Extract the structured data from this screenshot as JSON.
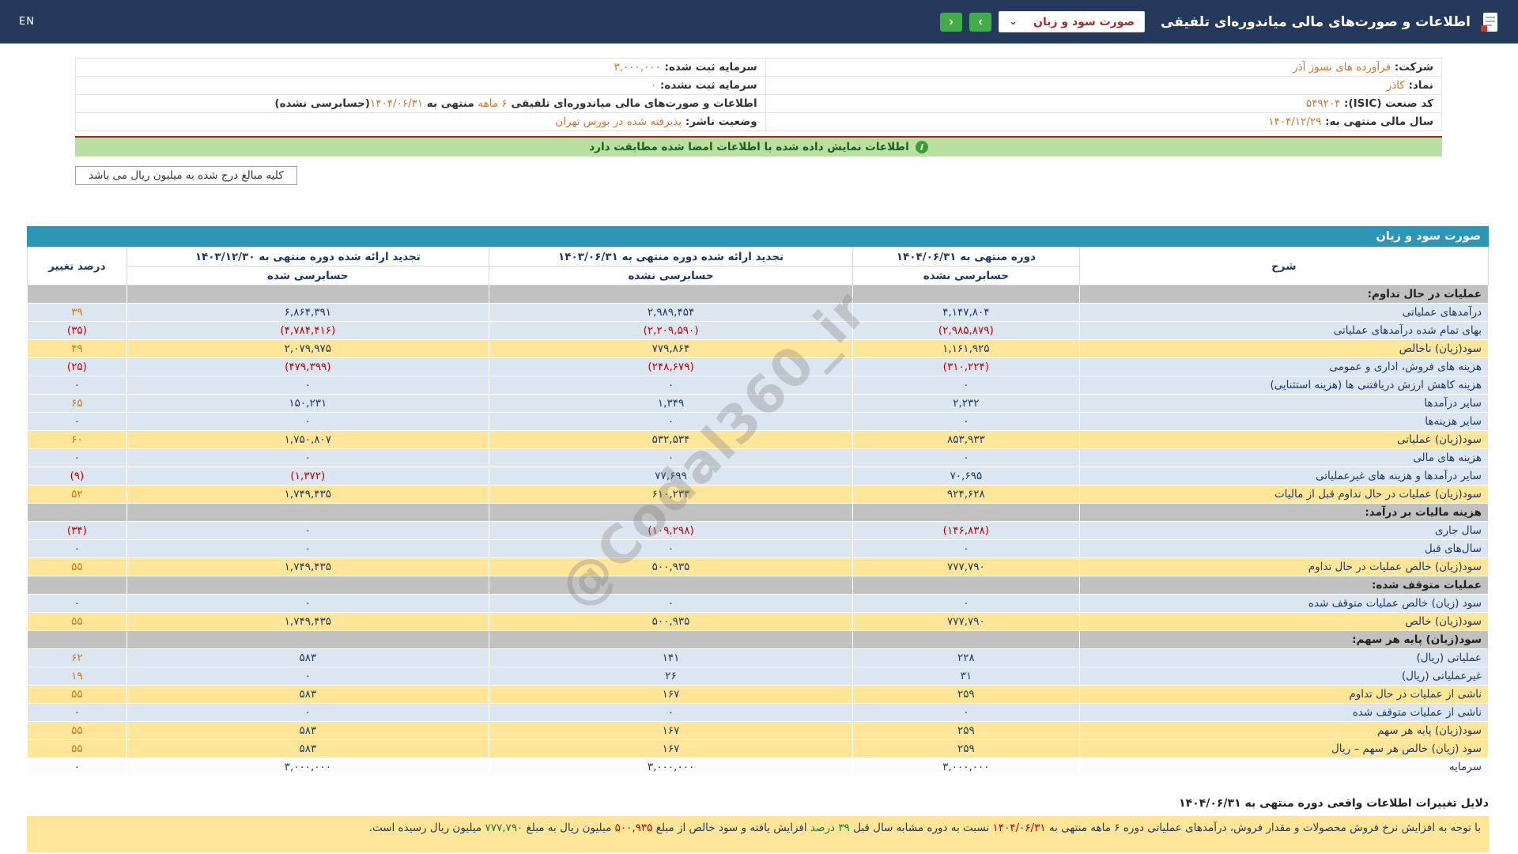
{
  "colors": {
    "topbar_bg": "#24395c",
    "accent_teal": "#2d96b5",
    "row_blue": "#dce6f1",
    "row_yellow": "#ffe699",
    "row_section": "#c1c1c1",
    "value_navy": "#1f3864",
    "value_red": "#c00000",
    "value_orange": "#bf7d1e",
    "info_orange": "#d0762c",
    "banner_green": "#b9dfa3",
    "nav_green": "#3fae49"
  },
  "topbar": {
    "title": "اطلاعات و صورت‌های مالی میاندوره‌ای تلفیقی",
    "statement_select_value": "صورت سود و زیان",
    "select_caret": "⌄",
    "nav_right_glyph": "›",
    "nav_left_glyph": "‹",
    "lang_toggle": "EN"
  },
  "info": {
    "rows": [
      {
        "right": [
          {
            "t": "شرکت: ",
            "c": "l"
          },
          {
            "t": "فرآورده های نسوز آذر",
            "c": "o"
          }
        ],
        "left": [
          {
            "t": "سرمایه ثبت شده: ",
            "c": "l"
          },
          {
            "t": "۳,۰۰۰,۰۰۰",
            "c": "o"
          }
        ]
      },
      {
        "right": [
          {
            "t": "نماد: ",
            "c": "l"
          },
          {
            "t": "کاذر",
            "c": "o"
          }
        ],
        "left": [
          {
            "t": "سرمایه ثبت نشده: ",
            "c": "l"
          },
          {
            "t": "۰",
            "c": "o"
          }
        ]
      },
      {
        "right": [
          {
            "t": "کد صنعت (ISIC): ",
            "c": "l"
          },
          {
            "t": "۵۴۹۲۰۴",
            "c": "o"
          }
        ],
        "left": [
          {
            "t": "اطلاعات و صورت‌های مالی میاندوره‌ای تلفیقی ",
            "c": "l"
          },
          {
            "t": "۶ ماهه",
            "c": "o"
          },
          {
            "t": " منتهی به ",
            "c": "l"
          },
          {
            "t": "۱۴۰۴/۰۶/۳۱",
            "c": "o"
          },
          {
            "t": "(حسابرسی نشده)",
            "c": "l"
          }
        ]
      },
      {
        "right": [
          {
            "t": "سال مالی منتهی به: ",
            "c": "l"
          },
          {
            "t": "۱۴۰۴/۱۲/۲۹",
            "c": "o"
          }
        ],
        "left": [
          {
            "t": "وضعیت ناشر: ",
            "c": "l"
          },
          {
            "t": "پذیرفته شده در بورس تهران",
            "c": "o"
          }
        ]
      }
    ]
  },
  "banner": {
    "text": "اطلاعات نمایش داده شده با اطلاعات امضا شده مطابقت دارد",
    "icon": "info-icon"
  },
  "units_note": "کلیه مبالغ درج شده به میلیون ریال می باشد",
  "statement": {
    "title": "صورت سود و زیان",
    "columns": {
      "desc": "شرح",
      "p1": "دوره منتهی به ۱۴۰۴/۰۶/۳۱",
      "p1_sub": "حسابرسی نشده",
      "p2": "تجدید ارائه شده دوره منتهی به ۱۴۰۳/۰۶/۳۱",
      "p2_sub": "حسابرسی نشده",
      "p3": "تجدید ارائه شده دوره منتهی به ۱۴۰۳/۱۲/۳۰",
      "p3_sub": "حسابرسی شده",
      "pct": "درصد تغییر"
    },
    "rows": [
      {
        "type": "section",
        "label": "عملیات در حال تداوم:"
      },
      {
        "type": "data",
        "style": "blue",
        "label": "درآمدهای عملیاتی",
        "values": [
          "۴,۱۴۷,۸۰۴",
          "۲,۹۸۹,۴۵۴",
          "۶,۸۶۴,۳۹۱"
        ],
        "pct": "۳۹"
      },
      {
        "type": "data",
        "style": "blue",
        "label": "بهای تمام شده درآمدهای عملیاتی",
        "values": [
          "(۲,۹۸۵,۸۷۹)",
          "(۲,۲۰۹,۵۹۰)",
          "(۴,۷۸۴,۴۱۶)"
        ],
        "pct": "(۳۵)"
      },
      {
        "type": "data",
        "style": "yellow",
        "label": "سود(زیان) ناخالص",
        "values": [
          "۱,۱۶۱,۹۲۵",
          "۷۷۹,۸۶۴",
          "۲,۰۷۹,۹۷۵"
        ],
        "pct": "۴۹"
      },
      {
        "type": "data",
        "style": "blue",
        "label": "هزینه های فروش، اداری و عمومی",
        "values": [
          "(۳۱۰,۲۲۴)",
          "(۲۴۸,۶۷۹)",
          "(۴۷۹,۳۹۹)"
        ],
        "pct": "(۲۵)"
      },
      {
        "type": "data",
        "style": "blue",
        "label": "هزینه کاهش ارزش دریافتنی ها (هزینه استثنایی)",
        "values": [
          "۰",
          "۰",
          "۰"
        ],
        "pct": "۰"
      },
      {
        "type": "data",
        "style": "blue",
        "label": "سایر درآمدها",
        "values": [
          "۲,۲۳۲",
          "۱,۳۴۹",
          "۱۵۰,۲۳۱"
        ],
        "pct": "۶۵"
      },
      {
        "type": "data",
        "style": "blue",
        "label": "سایر هزینه‌ها",
        "values": [
          "۰",
          "۰",
          "۰"
        ],
        "pct": "۰"
      },
      {
        "type": "data",
        "style": "yellow",
        "label": "سود(زیان) عملیاتی",
        "values": [
          "۸۵۳,۹۳۳",
          "۵۳۲,۵۳۴",
          "۱,۷۵۰,۸۰۷"
        ],
        "pct": "۶۰"
      },
      {
        "type": "data",
        "style": "blue",
        "label": "هزینه های مالی",
        "values": [
          "۰",
          "۰",
          "۰"
        ],
        "pct": "۰"
      },
      {
        "type": "data",
        "style": "blue",
        "label": "سایر درآمدها و هزینه های غیرعملیاتی",
        "values": [
          "۷۰,۶۹۵",
          "۷۷,۶۹۹",
          "(۱,۳۷۲)"
        ],
        "pct": "(۹)"
      },
      {
        "type": "data",
        "style": "yellow",
        "label": "سود(زیان) عملیات در حال تداوم قبل از مالیات",
        "values": [
          "۹۲۴,۶۲۸",
          "۶۱۰,۲۳۳",
          "۱,۷۴۹,۴۳۵"
        ],
        "pct": "۵۲"
      },
      {
        "type": "section",
        "label": "هزینه مالیات بر درآمد:"
      },
      {
        "type": "data",
        "style": "blue",
        "label": "سال جاری",
        "values": [
          "(۱۴۶,۸۳۸)",
          "(۱۰۹,۲۹۸)",
          "۰"
        ],
        "pct": "(۳۴)"
      },
      {
        "type": "data",
        "style": "blue",
        "label": "سال‌های قبل",
        "values": [
          "۰",
          "۰",
          "۰"
        ],
        "pct": "۰"
      },
      {
        "type": "data",
        "style": "yellow",
        "label": "سود(زیان) خالص عملیات در حال تداوم",
        "values": [
          "۷۷۷,۷۹۰",
          "۵۰۰,۹۳۵",
          "۱,۷۴۹,۴۳۵"
        ],
        "pct": "۵۵"
      },
      {
        "type": "section",
        "label": "عملیات متوقف شده:"
      },
      {
        "type": "data",
        "style": "blue",
        "label": "سود (زیان) خالص عملیات متوقف شده",
        "values": [
          "۰",
          "۰",
          "۰"
        ],
        "pct": "۰"
      },
      {
        "type": "data",
        "style": "yellow",
        "label": "سود(زیان) خالص",
        "values": [
          "۷۷۷,۷۹۰",
          "۵۰۰,۹۳۵",
          "۱,۷۴۹,۴۳۵"
        ],
        "pct": "۵۵"
      },
      {
        "type": "section",
        "label": "سود(زیان) پایه هر سهم:"
      },
      {
        "type": "data",
        "style": "blue",
        "label": "عملیاتی (ریال)",
        "values": [
          "۲۲۸",
          "۱۴۱",
          "۵۸۳"
        ],
        "pct": "۶۲"
      },
      {
        "type": "data",
        "style": "blue",
        "label": "غیرعملیاتی (ریال)",
        "values": [
          "۳۱",
          "۲۶",
          "۰"
        ],
        "pct": "۱۹"
      },
      {
        "type": "data",
        "style": "yellow",
        "label": "ناشی از عملیات در حال تداوم",
        "values": [
          "۲۵۹",
          "۱۶۷",
          "۵۸۳"
        ],
        "pct": "۵۵"
      },
      {
        "type": "data",
        "style": "blue",
        "label": "ناشی از عملیات متوقف شده",
        "values": [
          "۰",
          "۰",
          "۰"
        ],
        "pct": "۰"
      },
      {
        "type": "data",
        "style": "yellow",
        "label": "سود(زیان) پایه هر سهم",
        "values": [
          "۲۵۹",
          "۱۶۷",
          "۵۸۳"
        ],
        "pct": "۵۵"
      },
      {
        "type": "data",
        "style": "yellow",
        "label": "سود (زیان) خالص هر سهم – ریال",
        "values": [
          "۲۵۹",
          "۱۶۷",
          "۵۸۳"
        ],
        "pct": "۵۵"
      },
      {
        "type": "data",
        "style": "white",
        "label": "سرمایه",
        "values": [
          "۳,۰۰۰,۰۰۰",
          "۳,۰۰۰,۰۰۰",
          "۳,۰۰۰,۰۰۰"
        ],
        "pct": "۰"
      }
    ]
  },
  "footer": {
    "title": "دلایل تغییرات اطلاعات واقعی دوره منتهی به ۱۴۰۴/۰۶/۳۱",
    "note_segments": [
      {
        "t": "با توجه به افزایش نرخ فروش محصولات و مقدار فروش، درآمدهای عملیاتی دوره ۶ ماهه منتهی به ",
        "c": "d"
      },
      {
        "t": "۱۴۰۴/۰۶/۳۱",
        "c": "r"
      },
      {
        "t": " نسبت به دوره مشابه سال قبل ",
        "c": "d"
      },
      {
        "t": "۳۹ درصد",
        "c": "g"
      },
      {
        "t": " افزایش یافته و سود خالص از مبلغ ",
        "c": "d"
      },
      {
        "t": "۵۰۰,۹۳۵",
        "c": "r"
      },
      {
        "t": " میلیون ریال به مبلغ ",
        "c": "d"
      },
      {
        "t": "۷۷۷,۷۹۰",
        "c": "g"
      },
      {
        "t": " میلیون ریال رسیده است.",
        "c": "d"
      }
    ]
  },
  "watermark": {
    "text": "@Codal360_ir"
  }
}
